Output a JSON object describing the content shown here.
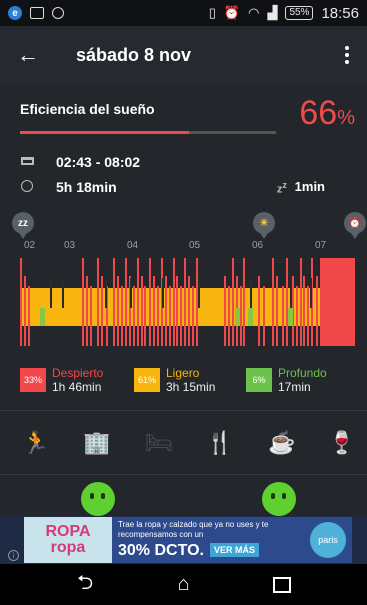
{
  "status_bar": {
    "time": "18:56",
    "battery": "55%",
    "icons_left": [
      "app-e-icon",
      "image-icon",
      "circle-icon"
    ],
    "icons_right": [
      "vibrate-icon",
      "alarm-icon",
      "wifi-icon",
      "signal-icon"
    ]
  },
  "app_bar": {
    "title": "sábado 8 nov",
    "back_icon": "arrow-back-icon",
    "menu_icon": "overflow-menu-icon"
  },
  "efficiency": {
    "label": "Eficiencia del sueño",
    "value": "66",
    "unit": "%",
    "fraction": 0.66,
    "accent": "#ee4b4b"
  },
  "sleep_window": "02:43 - 08:02",
  "duration": "5h 18min",
  "latency": "1min",
  "hypnogram": {
    "hour_labels": [
      "02",
      "03",
      "04",
      "05",
      "06",
      "07"
    ],
    "markers": [
      {
        "icon": "sleep-zz-icon",
        "glyph": "zz"
      },
      {
        "icon": "sun-icon",
        "glyph": "☀"
      },
      {
        "icon": "alarm-clock-icon",
        "glyph": "⏰"
      }
    ],
    "colors": {
      "awake": "#f0484b",
      "light": "#f8b40f",
      "deep": "#8bc63f",
      "background": "#23262b"
    }
  },
  "legend": [
    {
      "pct": "33%",
      "name": "Despierto",
      "duration": "1h 46min",
      "color": "#f0484b"
    },
    {
      "pct": "61%",
      "name": "Ligero",
      "duration": "3h 15min",
      "color": "#f8b40f"
    },
    {
      "pct": "6%",
      "name": "Profundo",
      "duration": "17min",
      "color": "#6cc24a"
    }
  ],
  "categories": [
    {
      "icon": "running-icon",
      "glyph": "🏃",
      "active": false
    },
    {
      "icon": "buildings-icon",
      "glyph": "🏢",
      "active": false
    },
    {
      "icon": "bed-icon",
      "glyph": "🛏",
      "active": false
    },
    {
      "icon": "fork-knife-icon",
      "glyph": "🍴",
      "active": true
    },
    {
      "icon": "coffee-icon",
      "glyph": "☕",
      "active": false
    },
    {
      "icon": "wine-glass-icon",
      "glyph": "🍷",
      "active": false
    }
  ],
  "ad": {
    "logo_top": "ROPA",
    "logo_bottom": "ropa",
    "tagline": "Trae la ropa y calzado que ya no uses y te recompensamos con un",
    "headline": "30% DCTO.",
    "cta": "VER MÁS",
    "brand": "paris",
    "info_icon": "i"
  },
  "nav": {
    "back": "back-nav-icon",
    "home": "home-nav-icon",
    "recent": "recent-apps-icon"
  }
}
